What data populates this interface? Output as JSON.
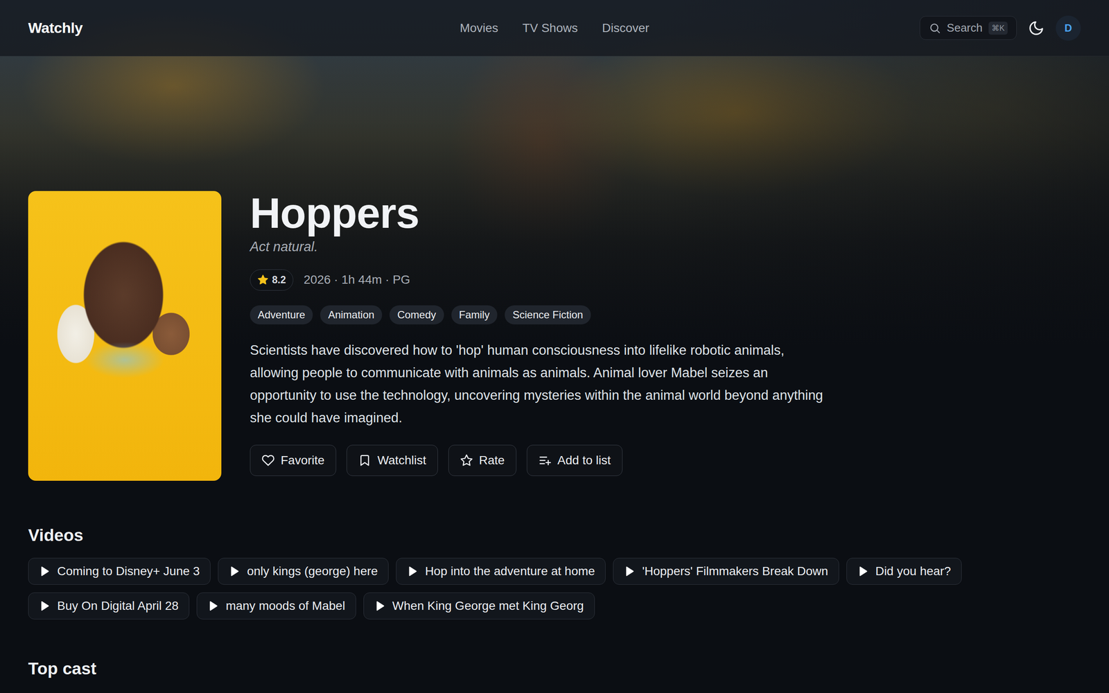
{
  "header": {
    "logo": "Watchly",
    "nav": [
      {
        "label": "Movies"
      },
      {
        "label": "TV Shows"
      },
      {
        "label": "Discover"
      }
    ],
    "search": {
      "label": "Search",
      "shortcut": "⌘K"
    },
    "avatar": "D"
  },
  "movie": {
    "title": "Hoppers",
    "tagline": "Act natural.",
    "rating": "8.2",
    "meta": "2026 · 1h 44m · PG",
    "genres": [
      "Adventure",
      "Animation",
      "Comedy",
      "Family",
      "Science Fiction"
    ],
    "overview": "Scientists have discovered how to 'hop' human consciousness into lifelike robotic animals, allowing people to communicate with animals as animals. Animal lover Mabel seizes an opportunity to use the technology, uncovering mysteries within the animal world beyond anything she could have imagined.",
    "actions": [
      {
        "label": "Favorite",
        "kind": "favorite"
      },
      {
        "label": "Watchlist",
        "kind": "watchlist"
      },
      {
        "label": "Rate",
        "kind": "rate"
      },
      {
        "label": "Add to list",
        "kind": "list"
      }
    ]
  },
  "videos": {
    "heading": "Videos",
    "items": [
      "Coming to Disney+ June 3",
      "only kings (george) here",
      "Hop into the adventure at home",
      "'Hoppers' Filmmakers Break Down",
      "Did you hear?",
      "Buy On Digital April 28",
      "many moods of Mabel",
      "When King George met King Georg"
    ]
  },
  "cast": {
    "heading": "Top cast"
  }
}
